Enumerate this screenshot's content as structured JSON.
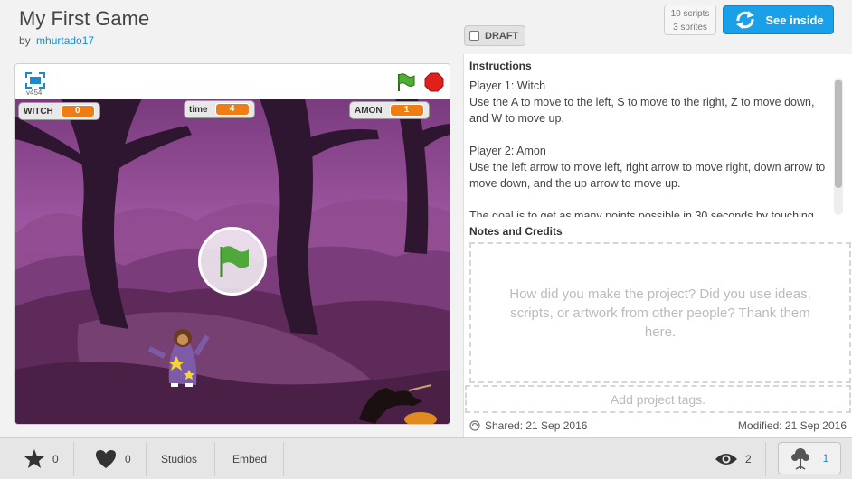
{
  "project": {
    "title": "My First Game",
    "by_label": "by",
    "author": "mhurtado17",
    "draft_label": "DRAFT",
    "scripts_count": "10 scripts",
    "sprites_count": "3 sprites",
    "see_inside_label": "See inside"
  },
  "player": {
    "version": "v454",
    "monitors": [
      {
        "label": "WITCH",
        "value": "0"
      },
      {
        "label": "time",
        "value": "4"
      },
      {
        "label": "AMON",
        "value": "1"
      }
    ]
  },
  "instructions": {
    "title": "Instructions",
    "p1_line1": "Player 1: Witch",
    "p1_line2": "Use the A to move to the left, S to move to the right, Z to move down, and W to move up.",
    "p2_line1": "Player 2: Amon",
    "p2_line2": "Use the left arrow to move left, right arrow to move right, down arrow to move down, and the up arrow to move up.",
    "p3": "The goal is to get as many points possible in 30 seconds by touching"
  },
  "notes": {
    "title": "Notes and Credits",
    "placeholder": "How did you make the project? Did you use ideas, scripts, or artwork from other people? Thank them here."
  },
  "tags": {
    "placeholder": "Add project tags."
  },
  "dates": {
    "shared": "Shared: 21 Sep 2016",
    "modified": "Modified: 21 Sep 2016"
  },
  "footer": {
    "favorites": "0",
    "loves": "0",
    "studios_label": "Studios",
    "embed_label": "Embed",
    "views": "2",
    "remixes": "1"
  },
  "colors": {
    "accent": "#1aa0e8",
    "monitor_value": "#ee7d16",
    "link": "#1a8ad0"
  }
}
